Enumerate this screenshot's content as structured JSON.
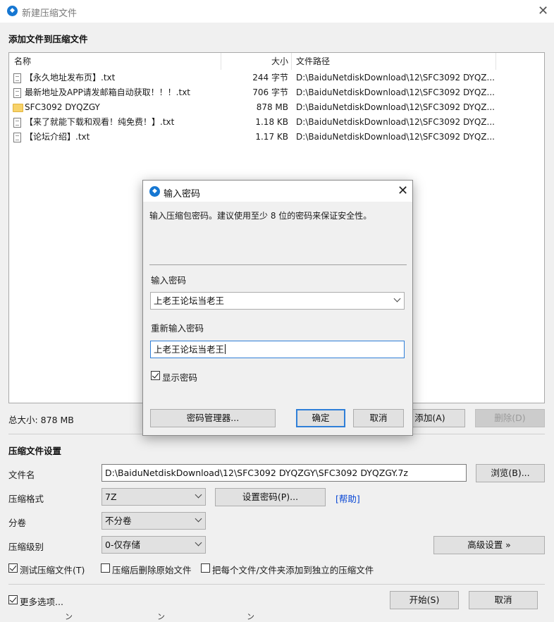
{
  "window": {
    "title": "新建压缩文件",
    "section_add": "添加文件到压缩文件"
  },
  "file_list": {
    "columns": [
      "名称",
      "大小",
      "文件路径"
    ],
    "rows": [
      {
        "type": "file",
        "name": "【永久地址发布页】.txt",
        "size": "244 字节",
        "path": "D:\\BaiduNetdiskDownload\\12\\SFC3092 DYQZ..."
      },
      {
        "type": "file",
        "name": "最新地址及APP请发邮箱自动获取！！！.txt",
        "size": "706 字节",
        "path": "D:\\BaiduNetdiskDownload\\12\\SFC3092 DYQZ..."
      },
      {
        "type": "folder",
        "name": "SFC3092 DYQZGY",
        "size": "878 MB",
        "path": "D:\\BaiduNetdiskDownload\\12\\SFC3092 DYQZ..."
      },
      {
        "type": "file",
        "name": "【来了就能下载和观看！纯免费！】.txt",
        "size": "1.18 KB",
        "path": "D:\\BaiduNetdiskDownload\\12\\SFC3092 DYQZ..."
      },
      {
        "type": "file",
        "name": "【论坛介绍】.txt",
        "size": "1.17 KB",
        "path": "D:\\BaiduNetdiskDownload\\12\\SFC3092 DYQZ..."
      }
    ]
  },
  "totals": {
    "total_size": "总大小: 878 MB"
  },
  "list_buttons": {
    "add": "添加(A)",
    "delete": "删除(D)"
  },
  "settings": {
    "section_title": "压缩文件设置",
    "filename_label": "文件名",
    "filename_value": "D:\\BaiduNetdiskDownload\\12\\SFC3092 DYQZGY\\SFC3092 DYQZGY.7z",
    "browse": "浏览(B)...",
    "format_label": "压缩格式",
    "format_value": "7Z",
    "set_password": "设置密码(P)...",
    "help": "[帮助]",
    "volume_label": "分卷",
    "volume_value": "不分卷",
    "level_label": "压缩级别",
    "level_value": "0-仅存储",
    "advanced": "高级设置 »",
    "test_archive": "测试压缩文件(T)",
    "delete_after": "压缩后删除原始文件",
    "each_separate": "把每个文件/文件夹添加到独立的压缩文件",
    "more_options": "更多选项...",
    "start": "开始(S)",
    "cancel": "取消",
    "test_checked": true,
    "delete_checked": false,
    "separate_checked": false,
    "more_checked": true
  },
  "bottom_bleed": [
    "ン",
    "ン",
    "ン"
  ],
  "dialog": {
    "title": "输入密码",
    "message": "输入压缩包密码。建议使用至少 8 位的密码来保证安全性。",
    "password_label": "输入密码",
    "password_value": "上老王论坛当老王",
    "reenter_label": "重新输入密码",
    "reenter_value": "上老王论坛当老王",
    "show_password": "显示密码",
    "show_checked": true,
    "manager": "密码管理器...",
    "ok": "确定",
    "cancel": "取消"
  },
  "colors": {
    "accent": "#2f7fd8",
    "link": "#0645d4",
    "folder": "#f7d26a"
  }
}
